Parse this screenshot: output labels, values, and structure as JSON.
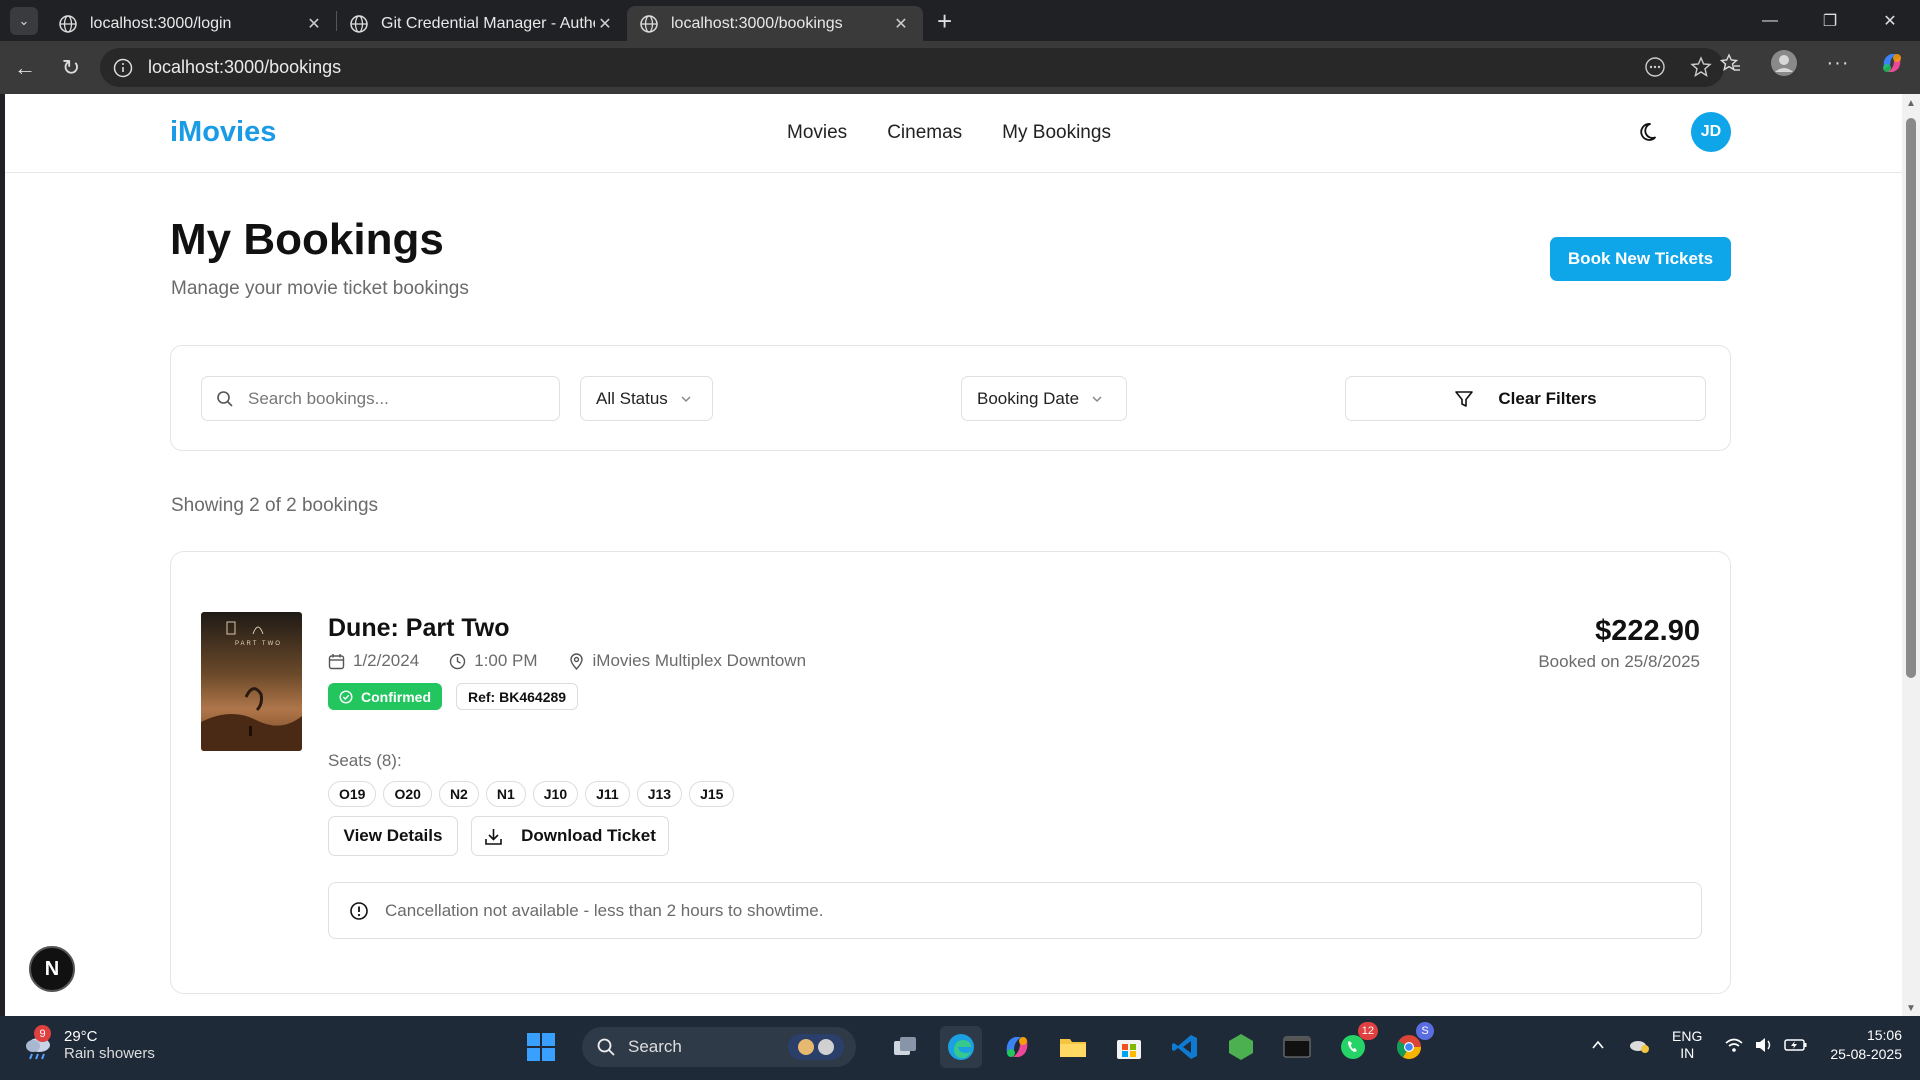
{
  "browser": {
    "tabs": [
      {
        "title": "localhost:3000/login"
      },
      {
        "title": "Git Credential Manager - Authent"
      },
      {
        "title": "localhost:3000/bookings"
      }
    ],
    "url": "localhost:3000/bookings"
  },
  "site": {
    "logo": "iMovies",
    "nav": [
      "Movies",
      "Cinemas",
      "My Bookings"
    ],
    "avatar_initials": "JD"
  },
  "page": {
    "title": "My Bookings",
    "subtitle": "Manage your movie ticket bookings",
    "primary_button": "Book New Tickets"
  },
  "filters": {
    "search_placeholder": "Search bookings...",
    "status_select": "All Status",
    "date_select": "Booking Date",
    "clear_button": "Clear Filters"
  },
  "results": {
    "summary": "Showing 2 of 2 bookings"
  },
  "booking": {
    "poster_text": "PART TWO",
    "movie": "Dune: Part Two",
    "date": "1/2/2024",
    "time": "1:00 PM",
    "cinema": "iMovies Multiplex Downtown",
    "status": "Confirmed",
    "ref": "Ref: BK464289",
    "price": "$222.90",
    "booked_on": "Booked on 25/8/2025",
    "seats_label": "Seats (8):",
    "seats": [
      "O19",
      "O20",
      "N2",
      "N1",
      "J10",
      "J11",
      "J13",
      "J15"
    ],
    "view_details": "View Details",
    "download": "Download Ticket",
    "notice": "Cancellation not available - less than 2 hours to showtime."
  },
  "floating_badge": "N",
  "taskbar": {
    "weather_badge": "9",
    "temperature": "29°C",
    "condition": "Rain showers",
    "search": "Search",
    "whatsapp_badge": "12",
    "chrome_badge": "S",
    "lang_top": "ENG",
    "lang_bottom": "IN",
    "time": "15:06",
    "date": "25-08-2025"
  },
  "colors": {
    "brand": "#1a9be6",
    "primary_button": "#0ea5e9",
    "confirmed": "#22c55e"
  }
}
